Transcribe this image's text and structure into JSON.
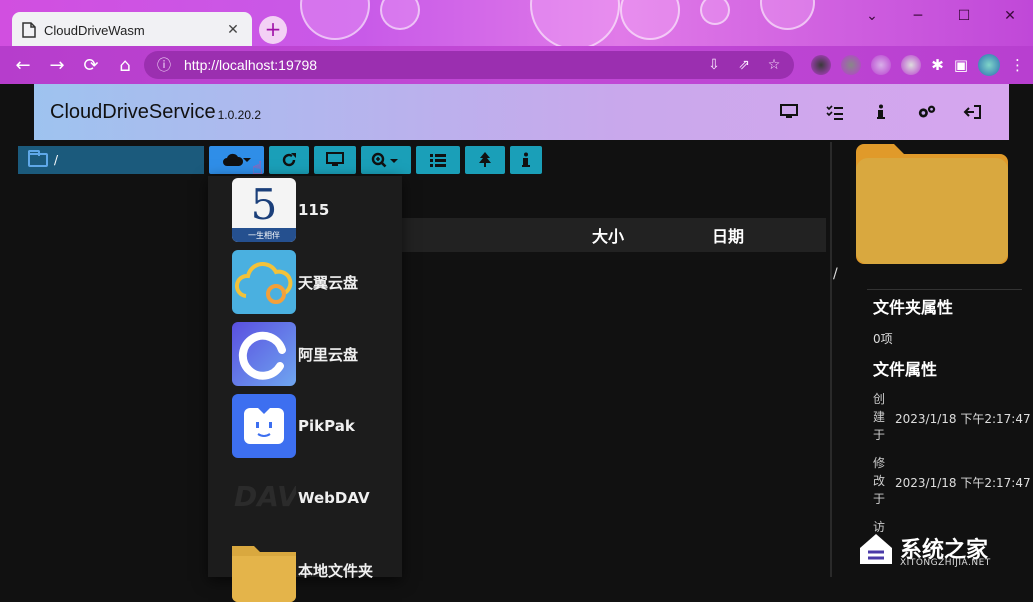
{
  "browser": {
    "tab_title": "CloudDriveWasm",
    "tab_close": "✕",
    "new_tab": "+",
    "url": "http://localhost:19798",
    "window": {
      "minimize": "─",
      "maximize": "☐",
      "close": "✕",
      "collapse": "⌄"
    }
  },
  "app": {
    "title": "CloudDriveService",
    "version": "1.0.20.2",
    "header_icons": [
      "monitor-icon",
      "checklist-icon",
      "info-icon",
      "gears-icon",
      "logout-icon"
    ]
  },
  "sidebar": {
    "items": [
      {
        "label": "/",
        "icon": "folder-icon"
      }
    ]
  },
  "toolbar": {
    "buttons": [
      "cloud-dropdown",
      "refresh",
      "monitor",
      "zoom-dropdown",
      "list",
      "tree",
      "info"
    ]
  },
  "file_list": {
    "columns": {
      "size": "大小",
      "date": "日期"
    }
  },
  "cloud_menu": {
    "items": [
      {
        "label": "115",
        "logo_text": "5",
        "logo_caption": "一生相伴"
      },
      {
        "label": "天翼云盘"
      },
      {
        "label": "阿里云盘"
      },
      {
        "label": "PikPak"
      },
      {
        "label": "WebDAV",
        "logo_text": "DAV"
      },
      {
        "label": "本地文件夹"
      }
    ]
  },
  "details": {
    "path": "/",
    "folder_props_title": "文件夹属性",
    "item_count": "0项",
    "file_props_title": "文件属性",
    "created_label": [
      "创",
      "建",
      "于"
    ],
    "created_value": "2023/1/18 下午2:17:47",
    "modified_label": [
      "修",
      "改",
      "于"
    ],
    "modified_value": "2023/1/18 下午2:17:47",
    "accessed_label": [
      "访"
    ]
  },
  "watermark": {
    "text": "系统之家",
    "sub": "XITONGZHIJIA.NET"
  },
  "colors": {
    "accent": "#2f8ee8",
    "button": "#1a9fb8",
    "folder": "#d9a83f",
    "sidebar_selected": "#1b5a7c"
  }
}
